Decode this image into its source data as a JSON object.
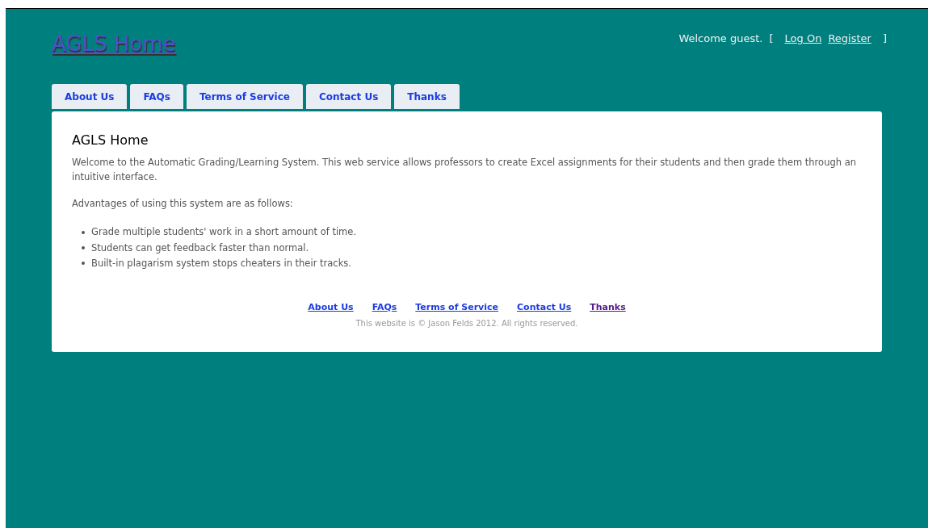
{
  "header": {
    "title": "AGLS Home",
    "welcome": "Welcome guest.",
    "open_bracket": "[",
    "links": [
      "Log On",
      "Register"
    ],
    "close_bracket": "]"
  },
  "tabs": [
    {
      "label": "About Us",
      "selected": false
    },
    {
      "label": "FAQs",
      "selected": false
    },
    {
      "label": "Terms of Service",
      "selected": false
    },
    {
      "label": "Contact Us",
      "selected": false
    },
    {
      "label": "Thanks",
      "selected": false
    }
  ],
  "content": {
    "heading": "AGLS Home",
    "intro": "Welcome to the Automatic Grading/Learning System. This web service allows professors to create Excel assignments for their students and then grade them through an intuitive interface.",
    "advantages_intro": "Advantages of using this system are as follows:",
    "advantages": [
      "Grade multiple students' work in a short amount of time.",
      "Students can get feedback faster than normal.",
      "Built-in plagarism system stops cheaters in their tracks."
    ]
  },
  "footer": {
    "links": [
      {
        "label": "About Us",
        "visited": false
      },
      {
        "label": "FAQs",
        "visited": false
      },
      {
        "label": "Terms of Service",
        "visited": false
      },
      {
        "label": "Contact Us",
        "visited": false
      },
      {
        "label": "Thanks",
        "visited": true
      }
    ],
    "copyright": "This website is © Jason Felds 2012. All rights reserved."
  }
}
